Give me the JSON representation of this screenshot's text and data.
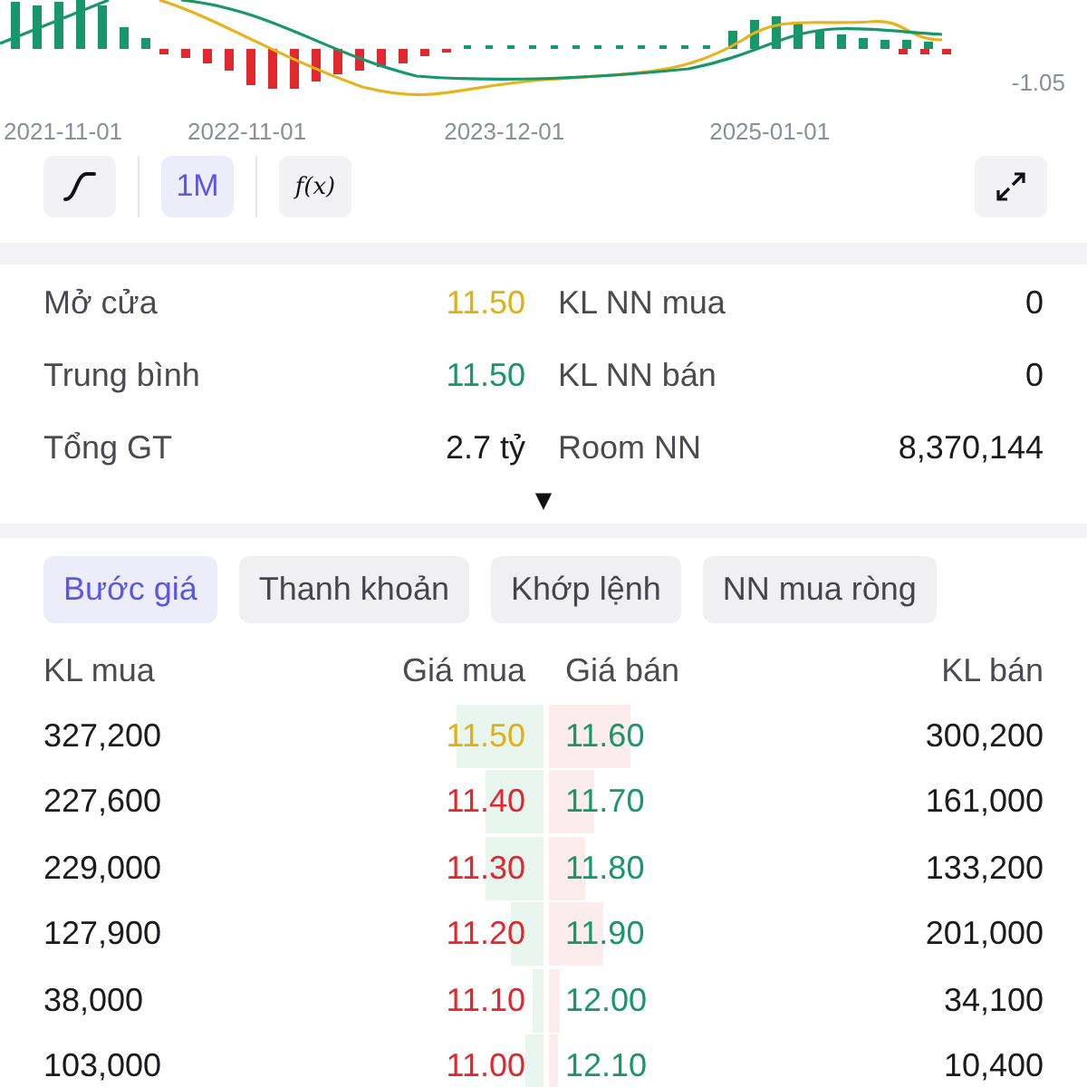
{
  "chart": {
    "axis_value": "-1.05",
    "dates": [
      "2021-11-01",
      "2022-11-01",
      "2023-12-01",
      "2025-01-01"
    ]
  },
  "toolbar": [
    {
      "kind": "curve"
    },
    {
      "kind": "text",
      "label": "1M",
      "selected": true
    },
    {
      "kind": "formula",
      "label": "f(x)",
      "selected": false
    },
    {
      "kind": "expand"
    }
  ],
  "stats": [
    {
      "label": "Mở cửa",
      "value": "11.50",
      "color": "#e1b012",
      "label_2": "KL NN mua",
      "value_2": "0"
    },
    {
      "label": "Trung bình",
      "value": "11.50",
      "color": "#17976a",
      "label_2": "KL NN bán",
      "value_2": "0"
    },
    {
      "label": "Tổng GT",
      "value": "2.7 tỷ",
      "color": "#1b1b1f",
      "label_2": "Room NN",
      "value_2": "8,370,144"
    }
  ],
  "more_toggle": "▼",
  "tabs": [
    {
      "label": "Bước giá",
      "selected": true
    },
    {
      "label": "Thanh khoản",
      "selected": false
    },
    {
      "label": "Khớp lệnh",
      "selected": false
    },
    {
      "label": "NN mua ròng",
      "selected": false
    }
  ],
  "order_book": {
    "columns": [
      "KL mua",
      "Giá mua",
      "Giá bán",
      "KL bán"
    ],
    "rows": [
      {
        "bid_volume": "327,200",
        "bid": {
          "price": "11.50",
          "color": "#e1b012"
        },
        "ask": {
          "price": "11.60",
          "color": "#17976a"
        },
        "ask_volume": "300,200"
      },
      {
        "bid_volume": "227,600",
        "bid": {
          "price": "11.40",
          "color": "#e0282e"
        },
        "ask": {
          "price": "11.70",
          "color": "#17976a"
        },
        "ask_volume": "161,000"
      },
      {
        "bid_volume": "229,000",
        "bid": {
          "price": "11.30",
          "color": "#e0282e"
        },
        "ask": {
          "price": "11.80",
          "color": "#17976a"
        },
        "ask_volume": "133,200"
      },
      {
        "bid_volume": "127,900",
        "bid": {
          "price": "11.20",
          "color": "#e0282e"
        },
        "ask": {
          "price": "11.90",
          "color": "#17976a"
        },
        "ask_volume": "201,000"
      },
      {
        "bid_volume": "38,000",
        "bid": {
          "price": "11.10",
          "color": "#e0282e"
        },
        "ask": {
          "price": "12.00",
          "color": "#17976a"
        },
        "ask_volume": "34,100"
      },
      {
        "bid_volume": "103,000",
        "bid": {
          "price": "11.00",
          "color": "#e0282e"
        },
        "ask": {
          "price": "12.10",
          "color": "#17976a"
        },
        "ask_volume": "10,400"
      }
    ]
  }
}
